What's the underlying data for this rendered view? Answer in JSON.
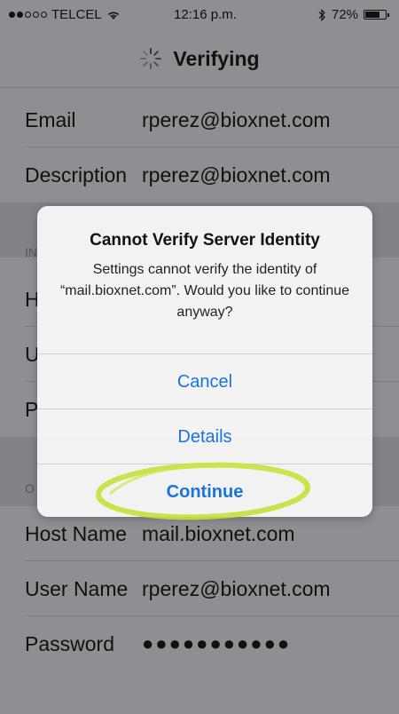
{
  "status_bar": {
    "carrier": "TELCEL",
    "time": "12:16 p.m.",
    "battery_percent": "72%",
    "battery_level": 0.72,
    "signal_bars_filled": 2,
    "signal_bars_total": 5,
    "icons": [
      "wifi-icon",
      "bluetooth-icon",
      "battery-icon"
    ]
  },
  "nav": {
    "title": "Verifying",
    "icon": "spinner-icon"
  },
  "account_rows": [
    {
      "label": "Email",
      "value": "rperez@bioxnet.com"
    },
    {
      "label": "Description",
      "value": "rperez@bioxnet.com"
    }
  ],
  "incoming_section": {
    "header": "IN",
    "rows": [
      {
        "label": "H"
      },
      {
        "label": "U"
      },
      {
        "label": "P"
      }
    ]
  },
  "outgoing_section": {
    "header": "O",
    "rows": [
      {
        "label": "Host Name",
        "value": "mail.bioxnet.com"
      },
      {
        "label": "User Name",
        "value": "rperez@bioxnet.com"
      },
      {
        "label": "Password",
        "value": "●●●●●●●●●●●"
      }
    ]
  },
  "alert": {
    "title": "Cannot Verify Server Identity",
    "message": "Settings cannot verify the identity of “mail.bioxnet.com”. Would you like to continue anyway?",
    "buttons": {
      "cancel": "Cancel",
      "details": "Details",
      "continue": "Continue"
    },
    "highlight_color": "#c7e03a",
    "button_color": "#1a74e0"
  }
}
